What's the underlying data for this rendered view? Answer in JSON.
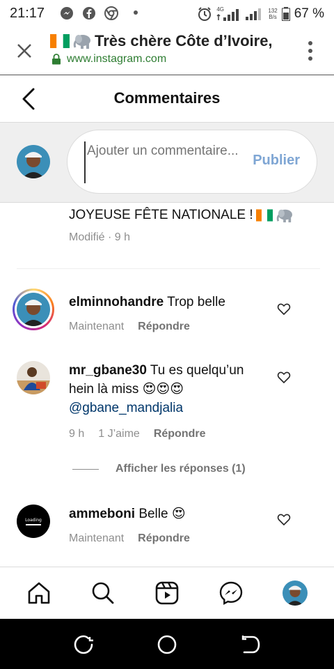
{
  "status_bar": {
    "time": "21:17",
    "network_label": "4G",
    "data_rate_top": "132",
    "data_rate_bottom": "B/s",
    "battery": "67 %"
  },
  "browser": {
    "page_title": "Très chère Côte d’Ivoire,",
    "url": "www.instagram.com"
  },
  "header": {
    "title": "Commentaires"
  },
  "composer": {
    "placeholder": "Ajouter un commentaire...",
    "publish_label": "Publier"
  },
  "caption": {
    "text": "JOYEUSE FÊTE NATIONALE !",
    "meta": "Modifié · 9 h"
  },
  "comments": [
    {
      "username": "elminnohandre",
      "text": "Trop belle",
      "time": "Maintenant",
      "likes": "",
      "reply_label": "Répondre"
    },
    {
      "username": "mr_gbane30",
      "text": "Tu es quelqu’un hein là miss 😍😍😍",
      "mention": "@gbane_mandjalia",
      "time": "9 h",
      "likes": "1 J’aime",
      "reply_label": "Répondre",
      "view_replies": "Afficher les réponses (1)"
    },
    {
      "username": "ammeboni",
      "text": "Belle 😍",
      "time": "Maintenant",
      "likes": "",
      "reply_label": "Répondre",
      "avatar_text": "Loading"
    }
  ],
  "colors": {
    "publish": "#7fa6d4",
    "mention": "#00376b",
    "secure_lock": "#2e7d32",
    "meta_grey": "#8e8e8e"
  },
  "icons": {
    "bottom_nav": [
      "home-icon",
      "search-icon",
      "reels-icon",
      "messenger-icon",
      "profile-avatar"
    ]
  }
}
